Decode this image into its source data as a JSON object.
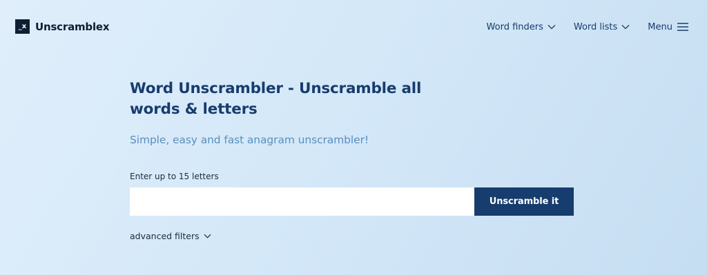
{
  "header": {
    "logo_mark": "_x",
    "logo_text": "Unscramblex",
    "nav": [
      {
        "label": "Word finders",
        "icon": "chevron-down-icon"
      },
      {
        "label": "Word lists",
        "icon": "chevron-down-icon"
      },
      {
        "label": "Menu",
        "icon": "hamburger-menu-icon"
      }
    ]
  },
  "main": {
    "title": "Word Unscrambler - Unscramble all words & letters",
    "subtitle": "Simple, easy and fast anagram unscrambler!",
    "input_label": "Enter up to 15 letters",
    "input_value": "",
    "input_placeholder": "",
    "submit_label": "Unscramble it",
    "advanced_filters_label": "advanced filters"
  },
  "colors": {
    "brand_dark": "#173c6e",
    "subtitle": "#5a8fbd",
    "background_start": "#e0eefb",
    "background_end": "#c6def2"
  }
}
